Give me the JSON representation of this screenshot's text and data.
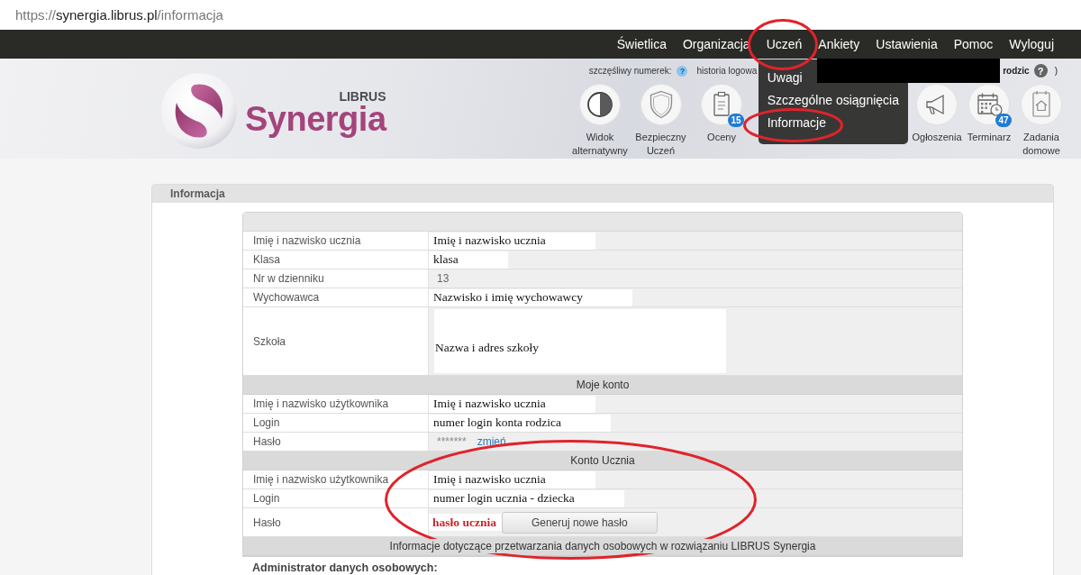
{
  "address_bar": {
    "scheme": "https://",
    "host": "synergia.librus.pl",
    "path": "/informacja"
  },
  "nav": {
    "items": [
      {
        "label": "Świetlica"
      },
      {
        "label": "Organizacja"
      },
      {
        "label": "Uczeń",
        "menu": [
          "Uwagi",
          "Szczególne osiągnięcia",
          "Informacje"
        ]
      },
      {
        "label": "Ankiety"
      },
      {
        "label": "Ustawienia"
      },
      {
        "label": "Pomoc"
      },
      {
        "label": "Wyloguj"
      }
    ]
  },
  "header": {
    "logo": {
      "small": "LIBRUS",
      "name": "Synergia"
    },
    "status": {
      "lucky_number": "szczęśliwy numerek:",
      "lucky_help": "?",
      "login_history": "historia logowa",
      "role": "rodzic",
      "role_help": "?",
      "closing": ")"
    },
    "shortcuts": {
      "before_menu": [
        {
          "kind": "contrast",
          "label": "Widok alternatywny"
        },
        {
          "kind": "shield",
          "label": "Bezpieczny Uczeń"
        },
        {
          "kind": "grades",
          "label": "Oceny",
          "badge": "15"
        }
      ],
      "after_menu": [
        {
          "kind": "announcements",
          "label": "Ogłoszenia"
        },
        {
          "kind": "calendar",
          "label": "Terminarz",
          "badge": "47"
        },
        {
          "kind": "homework",
          "label": "Zadania domowe"
        }
      ]
    }
  },
  "panel": {
    "title": "Informacja",
    "rows": [
      {
        "kind": "field",
        "label": "Imię i nazwisko ucznia",
        "value": "Imię i nazwisko ucznia",
        "edited": true
      },
      {
        "kind": "field",
        "label": "Klasa",
        "value": "klasa",
        "edited": true
      },
      {
        "kind": "field",
        "label": "Nr w dzienniku",
        "value": "13",
        "edited": false
      },
      {
        "kind": "field",
        "label": "Wychowawca",
        "value": "Nazwisko i imię wychowawcy",
        "edited": true
      },
      {
        "kind": "tall-field",
        "label": "Szkoła",
        "value": "Nazwa i adres szkoły",
        "edited": true
      },
      {
        "kind": "section",
        "title": "Moje konto"
      },
      {
        "kind": "field",
        "label": "Imię i nazwisko użytkownika",
        "value": "Imię i nazwisko ucznia",
        "edited": true
      },
      {
        "kind": "field",
        "label": "Login",
        "value": "numer login konta rodzica",
        "edited": true
      },
      {
        "kind": "password",
        "label": "Hasło",
        "value": "*******",
        "link": "zmień"
      },
      {
        "kind": "section",
        "title": "Konto Ucznia"
      },
      {
        "kind": "field",
        "label": "Imię i nazwisko użytkownika",
        "value": "Imię i nazwisko ucznia",
        "edited": true
      },
      {
        "kind": "field",
        "label": "Login",
        "value": "numer login ucznia - dziecka",
        "edited": true
      },
      {
        "kind": "password-generate",
        "label": "Hasło",
        "value": "hasło ucznia",
        "button": "Generuj nowe hasło"
      },
      {
        "kind": "section",
        "title": "Informacje dotyczące przetwarzania danych osobowych w rozwiązaniu LIBRUS Synergia"
      }
    ],
    "note_heading": "Administrator danych osobowych:"
  }
}
